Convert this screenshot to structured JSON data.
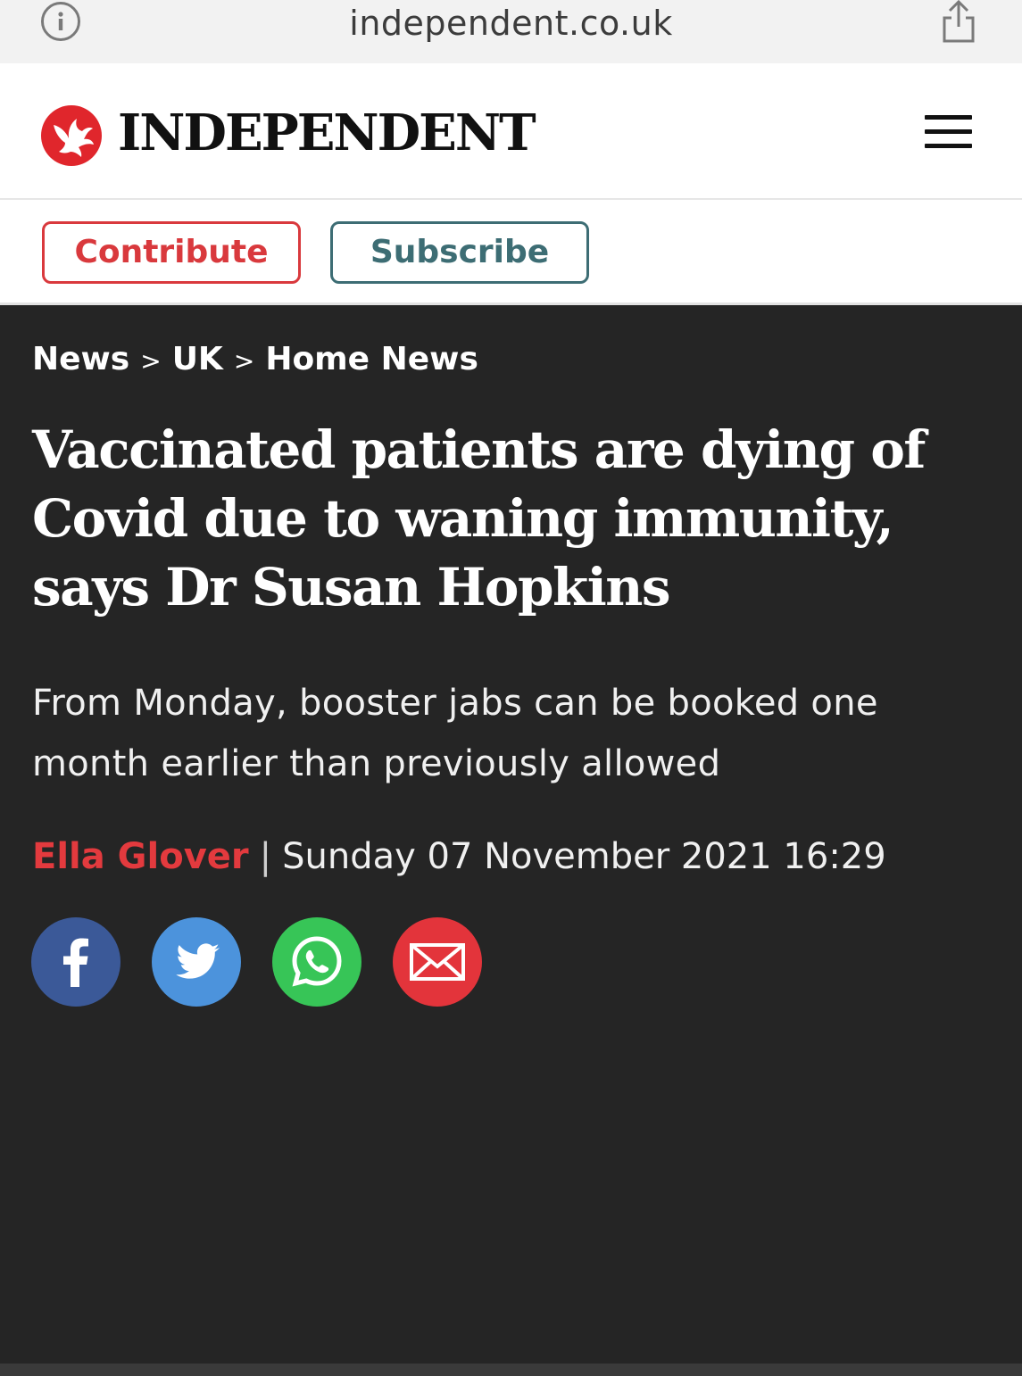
{
  "browser": {
    "url": "independent.co.uk",
    "icons": {
      "info": "info-icon",
      "share": "share-icon"
    }
  },
  "masthead": {
    "brand": "INDEPENDENT",
    "icons": {
      "logo": "eagle-logo-icon",
      "menu": "hamburger-menu-icon"
    }
  },
  "actions": {
    "contribute_label": "Contribute",
    "subscribe_label": "Subscribe"
  },
  "breadcrumb": {
    "items": [
      "News",
      "UK",
      "Home News"
    ],
    "separator": ">"
  },
  "article": {
    "headline": "Vaccinated patients are dying of Covid due to waning immunity, says Dr Susan Hopkins",
    "standfirst": "From Monday, booster jabs can be booked one month earlier than previously allowed",
    "author": "Ella Glover",
    "byline_divider": "|",
    "date": "Sunday 07 November 2021 16:29"
  },
  "share": {
    "items": [
      {
        "name": "facebook-icon",
        "color": "#3b5998"
      },
      {
        "name": "twitter-icon",
        "color": "#4c93dc"
      },
      {
        "name": "whatsapp-icon",
        "color": "#37c557"
      },
      {
        "name": "email-icon",
        "color": "#e3343b"
      }
    ]
  },
  "colors": {
    "brand_red": "#d9393d",
    "subscribe_teal": "#3d6d74",
    "article_background": "#252525",
    "author_red": "#e33a3e"
  }
}
